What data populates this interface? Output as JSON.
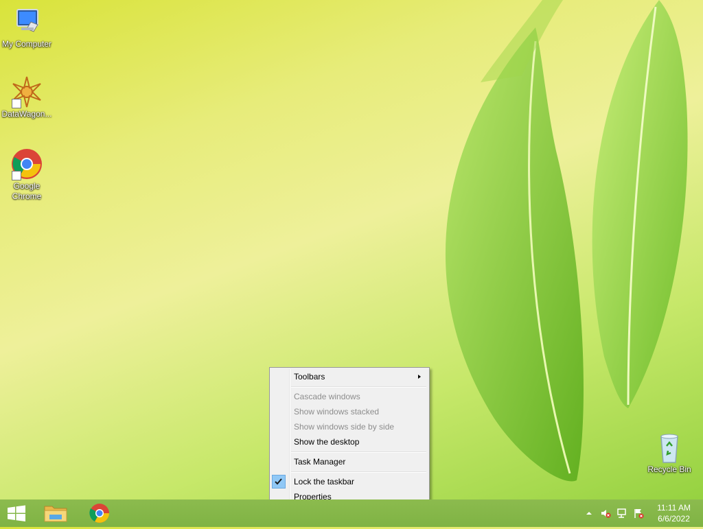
{
  "desktop": {
    "icons": [
      {
        "label": "My Computer",
        "icon": "computer-icon"
      },
      {
        "label": "DataWagon...",
        "icon": "datawagon-icon"
      },
      {
        "label": "Google Chrome",
        "icon": "chrome-icon"
      },
      {
        "label": "Recycle Bin",
        "icon": "recycle-bin-icon"
      }
    ]
  },
  "context_menu": {
    "items": [
      {
        "label": "Toolbars",
        "enabled": true,
        "submenu": true
      },
      {
        "label": "Cascade windows",
        "enabled": false
      },
      {
        "label": "Show windows stacked",
        "enabled": false
      },
      {
        "label": "Show windows side by side",
        "enabled": false
      },
      {
        "label": "Show the desktop",
        "enabled": true
      },
      {
        "label": "Task Manager",
        "enabled": true
      },
      {
        "label": "Lock the taskbar",
        "enabled": true,
        "checked": true
      },
      {
        "label": "Properties",
        "enabled": true
      }
    ]
  },
  "taskbar": {
    "buttons": [
      {
        "name": "start-button",
        "icon": "windows-logo-icon"
      },
      {
        "name": "file-explorer-button",
        "icon": "folder-icon"
      },
      {
        "name": "chrome-button",
        "icon": "chrome-icon"
      }
    ],
    "tray_icons": [
      "show-hidden-icons-icon",
      "volume-muted-icon",
      "network-icon",
      "action-center-icon"
    ],
    "clock": {
      "time": "11:11 AM",
      "date": "6/6/2022"
    }
  },
  "colors": {
    "taskbar": "#7fb344",
    "menu_bg": "#f0f0f0",
    "check_highlight": "#90c8f6"
  }
}
